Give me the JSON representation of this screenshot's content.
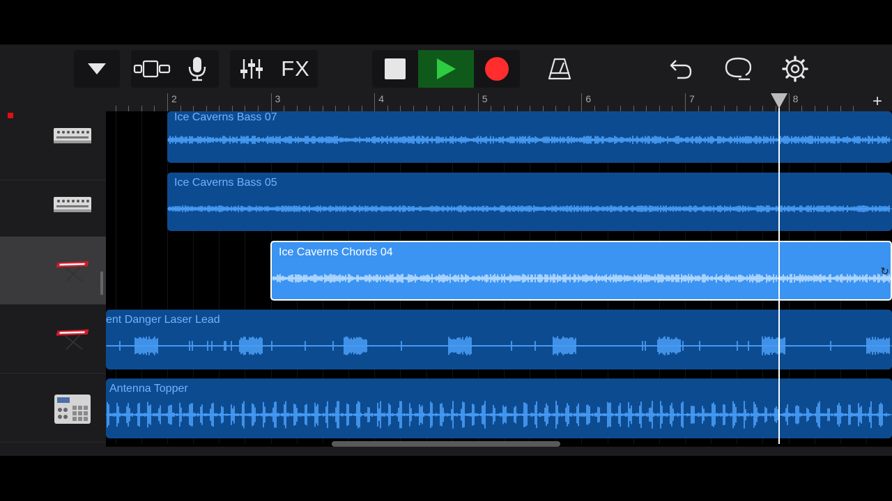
{
  "toolbar": {
    "tracks_menu_icon": "triangle-down-icon",
    "view_toggle_icon": "track-view-icon",
    "mic_icon": "microphone-icon",
    "mixer_icon": "sliders-icon",
    "fx_label": "FX",
    "stop_icon": "stop-icon",
    "play_icon": "play-icon",
    "record_icon": "record-icon",
    "metronome_icon": "metronome-icon",
    "undo_icon": "undo-icon",
    "loop_browser_icon": "loop-icon",
    "settings_icon": "gear-icon",
    "colors": {
      "play_bg": "#0f5a1a",
      "play_glyph": "#2ecc40",
      "record": "#ff2d2d",
      "accent": "#3b93f2"
    }
  },
  "ruler": {
    "bars": [
      "2",
      "3",
      "4",
      "5",
      "6",
      "7",
      "8"
    ],
    "add_track_label": "+"
  },
  "tracks": [
    {
      "instrument": "synth-module",
      "record_enabled": true
    },
    {
      "instrument": "synth-module",
      "record_enabled": false
    },
    {
      "instrument": "red-keyboard",
      "selected": true
    },
    {
      "instrument": "red-keyboard"
    },
    {
      "instrument": "drum-machine"
    }
  ],
  "regions": [
    {
      "name": "Ice Caverns Bass 07"
    },
    {
      "name": "Ice Caverns Bass 05"
    },
    {
      "name": "Ice Caverns Chords 04",
      "selected": true
    },
    {
      "name": "ent Danger Laser Lead"
    },
    {
      "name": "Antenna Topper"
    }
  ],
  "playhead_bar": 7.9
}
